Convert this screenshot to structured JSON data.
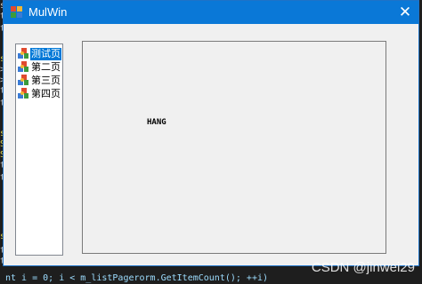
{
  "window": {
    "title": "MulWin",
    "close_glyph": "✕",
    "app_icon": "application-icon"
  },
  "tabs_list": {
    "items": [
      {
        "label": "测试页",
        "icon": "page-icon",
        "selected": true
      },
      {
        "label": "第二页",
        "icon": "page-icon",
        "selected": false
      },
      {
        "label": "第三页",
        "icon": "page-icon",
        "selected": false
      },
      {
        "label": "第四页",
        "icon": "page-icon",
        "selected": false
      }
    ]
  },
  "content": {
    "text": "HANG"
  },
  "background_code": {
    "bottom_line": "nt i = 0; i < m_listPagerorm.GetItemCount(); ++i)"
  },
  "watermark": "CSDN @jinwei29",
  "colors": {
    "titlebar": "#0a78d7",
    "selection": "#0078d7",
    "window_bg": "#f0f0f0"
  }
}
